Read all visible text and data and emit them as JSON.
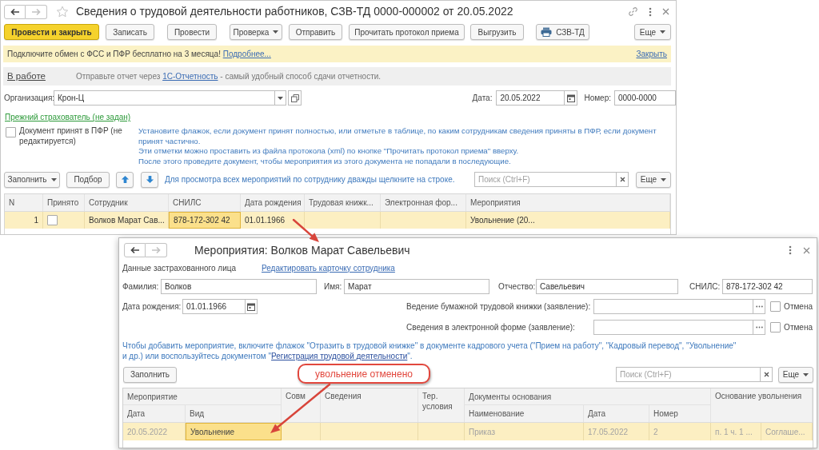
{
  "document_window": {
    "navigation": {
      "back_disabled": false,
      "forward_disabled": true
    },
    "title": "Сведения о трудовой деятельности работников, СЗВ-ТД 0000-000002 от 20.05.2022",
    "toolbar": [
      {
        "label": "Провести и закрыть",
        "kind": "primary"
      },
      {
        "label": "Записать",
        "kind": "plain"
      },
      {
        "label": "Провести",
        "kind": "plain"
      },
      {
        "label": "Проверка",
        "kind": "menu"
      },
      {
        "label": "Отправить",
        "kind": "plain"
      },
      {
        "label": "Прочитать протокол приема",
        "kind": "plain"
      },
      {
        "label": "Выгрузить",
        "kind": "plain"
      },
      {
        "label": "СЗВ-ТД",
        "kind": "print"
      }
    ],
    "more_button": "Еще",
    "promo_bar": {
      "text": "Подключите обмен с ФСС и ПФР бесплатно на 3 месяца!",
      "link": "Подробнее...",
      "close_link": "Закрыть"
    },
    "report_bar": {
      "status_link": "В работе",
      "text_before": "Отправьте отчет через",
      "link": "1С-Отчетность",
      "text_after": "- самый удобный способ сдачи отчетности."
    },
    "organization": {
      "label": "Организация:",
      "value": "Крон-Ц"
    },
    "date": {
      "label": "Дата:",
      "value": "20.05.2022"
    },
    "number": {
      "label": "Номер:",
      "value": "0000-0000"
    },
    "previous_insurer_link": "Прежний страхователь (не задан)",
    "accepted_in_pfr": {
      "label": "Документ принят в ПФР (не редактируется)",
      "checked": false
    },
    "hint_lines": [
      "Установите флажок, если документ принят полностью, или отметьте в таблице, по каким сотрудникам сведения приняты в ПФР, если документ принят частично.",
      "Эти отметки можно проставить из файла протокола (xml) по кнопке \"Прочитать протокол приема\" вверху.",
      "После этого проведите документ, чтобы мероприятия из этого документа не попадали в последующие."
    ],
    "table_toolbar": {
      "fill_button": "Заполнить",
      "pick_button": "Подбор",
      "hint": "Для просмотра всех мероприятий по сотруднику дважды щелкните на строке.",
      "search": {
        "placeholder": "Поиск (Ctrl+F)"
      },
      "more_button": "Еще"
    },
    "table": {
      "columns": [
        "N",
        "Принято",
        "Сотрудник",
        "СНИЛС",
        "Дата рождения",
        "Трудовая книжк...",
        "Электронная фор...",
        "Мероприятия"
      ],
      "rows": [
        {
          "selected": true,
          "cells": [
            {
              "kind": "text",
              "text": "1",
              "selected": false
            },
            {
              "kind": "checkbox",
              "checked": false,
              "selected": false
            },
            {
              "kind": "text",
              "text": "Волков Марат Сав...",
              "selected": false
            },
            {
              "kind": "text",
              "text": "878-172-302 42",
              "selected": true
            },
            {
              "kind": "text",
              "text": "01.01.1966",
              "selected": false
            },
            {
              "kind": "empty",
              "selected": false
            },
            {
              "kind": "empty",
              "selected": false
            },
            {
              "kind": "text",
              "text": "Увольнение (20...",
              "selected": false
            }
          ]
        }
      ]
    }
  },
  "events_window": {
    "navigation": {
      "back_disabled": false,
      "forward_disabled": true
    },
    "title": "Мероприятия: Волков Марат Савельевич",
    "section_label": "Данные застрахованного лица",
    "edit_link": "Редактировать карточку сотрудника",
    "fields": [
      {
        "label": "Фамилия:",
        "value": "Волков"
      },
      {
        "label": "Имя:",
        "value": "Марат"
      },
      {
        "label": "Отчество:",
        "value": "Савельевич"
      },
      {
        "label": "СНИЛС:",
        "value": "878-172-302 42"
      }
    ],
    "birth_date": {
      "label": "Дата рождения:",
      "value": "01.01.1966"
    },
    "statements": [
      {
        "label": "Ведение бумажной трудовой книжки (заявление):",
        "cancel": {
          "label": "Отмена",
          "checked": false
        }
      },
      {
        "label": "Сведения в электронной форме (заявление):",
        "cancel": {
          "label": "Отмена",
          "checked": false
        }
      }
    ],
    "hint": {
      "text_before": "Чтобы добавить мероприятие, включите флажок \"Отразить в трудовой книжке\" в документе кадрового учета (\"Прием на работу\", \"Кадровый перевод\", \"Увольнение\" и др.) или воспользуйтесь документом \"",
      "link": "Регистрация трудовой деятельности",
      "text_after": "\"."
    },
    "table_toolbar": {
      "fill_button": "Заполнить",
      "search": {
        "placeholder": "Поиск (Ctrl+F)"
      },
      "more_button": "Еще"
    },
    "table": {
      "header_groups": [
        {
          "label": "Мероприятие",
          "children": [
            "Дата",
            "Вид"
          ]
        },
        {
          "label": "Совм"
        },
        {
          "label": "Сведения"
        },
        {
          "label": "Тер. условия"
        },
        {
          "label": "Документы основания",
          "children": [
            "Наименование",
            "Дата",
            "Номер"
          ]
        },
        {
          "label": "Основание увольнения"
        }
      ],
      "rows": [
        {
          "selected": true,
          "cells": [
            {
              "text": "20.05.2022",
              "disabled": true,
              "selected": false
            },
            {
              "text": "Увольнение",
              "disabled": false,
              "selected": true
            },
            {
              "selected": false
            },
            {
              "selected": false
            },
            {
              "selected": false
            },
            {
              "text": "Приказ",
              "disabled": true,
              "selected": false
            },
            {
              "text": "17.05.2022",
              "disabled": true,
              "selected": false
            },
            {
              "text": "2",
              "disabled": true,
              "selected": false
            },
            {
              "text": "п. 1 ч. 1 ...",
              "disabled": true,
              "selected": false
            },
            {
              "text": "Соглаше...",
              "disabled": true,
              "selected": false
            }
          ]
        }
      ]
    }
  },
  "callout": {
    "text": "увольнение отменено"
  }
}
